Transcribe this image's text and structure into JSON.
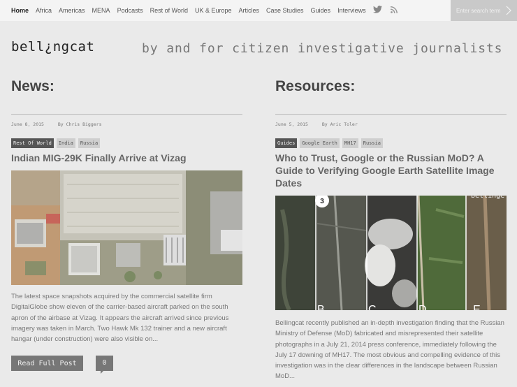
{
  "nav": {
    "items": [
      "Home",
      "Africa",
      "Americas",
      "MENA",
      "Podcasts",
      "Rest of World",
      "UK & Europe",
      "Articles",
      "Case Studies",
      "Guides",
      "Interviews"
    ],
    "search_placeholder": "Enter search term",
    "icons": [
      "twitter-icon",
      "rss-icon"
    ]
  },
  "header": {
    "logo": "bell¿ngcat",
    "tagline": "by and for citizen investigative journalists"
  },
  "news": {
    "title": "News:",
    "date": "June 8, 2015",
    "author": "By Chris Biggers",
    "tags": [
      "Rest Of World",
      "India",
      "Russia"
    ],
    "post_title": "Indian MIG-29K Finally Arrive at Vizag",
    "excerpt": "The latest space snapshots acquired by the commercial satellite firm DigitalGlobe show eleven of the carrier-based aircraft parked on the south apron of the airbase at Vizag. It appears the aircraft arrived since previous imagery was taken in March. Two Hawk Mk 132 trainer and a new aircraft hangar (under construction) were also visible on...",
    "read_more": "Read Full Post",
    "comments": "0"
  },
  "resources": {
    "title": "Resources:",
    "date": "June 5, 2015",
    "author": "By Aric Toler",
    "tags": [
      "Guides",
      "Google Earth",
      "MH17",
      "Russia"
    ],
    "post_title": "Who to Trust, Google or the Russian MoD? A Guide to Verifying Google Earth Satellite Image Dates",
    "image_labels": {
      "badge": "3",
      "watermark": "bellinge",
      "panels": [
        "B",
        "C",
        "D",
        "E"
      ]
    },
    "excerpt": "Bellingcat recently published an in-depth investigation finding that the Russian Ministry of Defense (MoD) fabricated and misrepresented their satellite photographs in a July 21, 2014 press conference, immediately following the July 17 downing of MH17. The most obvious and compelling evidence of this investigation was in the clear differences in the landscape between Russian MoD..."
  }
}
